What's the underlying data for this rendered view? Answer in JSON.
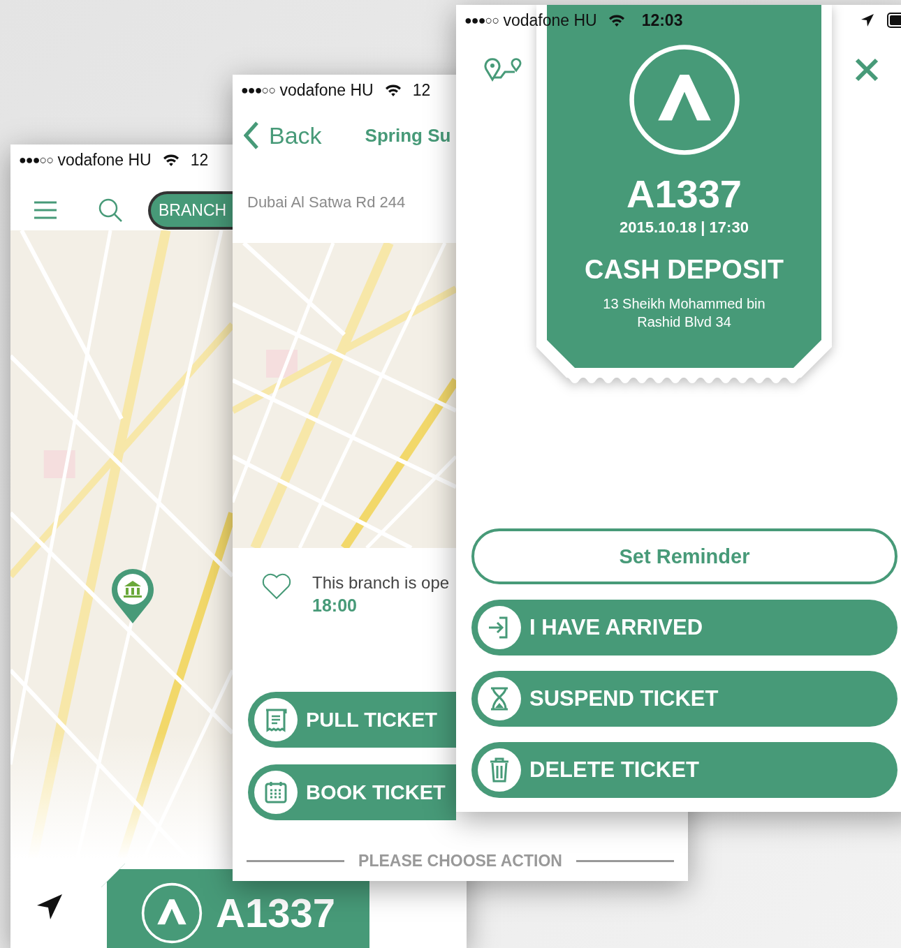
{
  "map_screen": {
    "status": {
      "signal": "●●●○○",
      "carrier": "vodafone HU",
      "time": "12"
    },
    "filter": "BRANCH",
    "ticket": {
      "number": "A1337"
    }
  },
  "branch_screen": {
    "status": {
      "signal": "●●●○○",
      "carrier": "vodafone HU",
      "time": "12"
    },
    "back": "Back",
    "title": "Spring Su",
    "address": "Dubai Al Satwa Rd 244",
    "hours_text": "This branch is ope",
    "hours_time": "18:00",
    "actions": [
      {
        "label": "PULL TICKET"
      },
      {
        "label": "BOOK TICKET"
      }
    ],
    "footer": "PLEASE CHOOSE ACTION"
  },
  "ticket_screen": {
    "status": {
      "signal": "●●●○○",
      "carrier": "vodafone HU",
      "time": "12:03"
    },
    "ticket": {
      "number": "A1337",
      "datetime": "2015.10.18 | 17:30",
      "service": "CASH DEPOSIT",
      "address": "13 Sheikh Mohammed bin Rashid Blvd 34"
    },
    "reminder": "Set Reminder",
    "actions": [
      {
        "label": "I HAVE ARRIVED"
      },
      {
        "label": "SUSPEND TICKET"
      },
      {
        "label": "DELETE TICKET"
      }
    ]
  }
}
